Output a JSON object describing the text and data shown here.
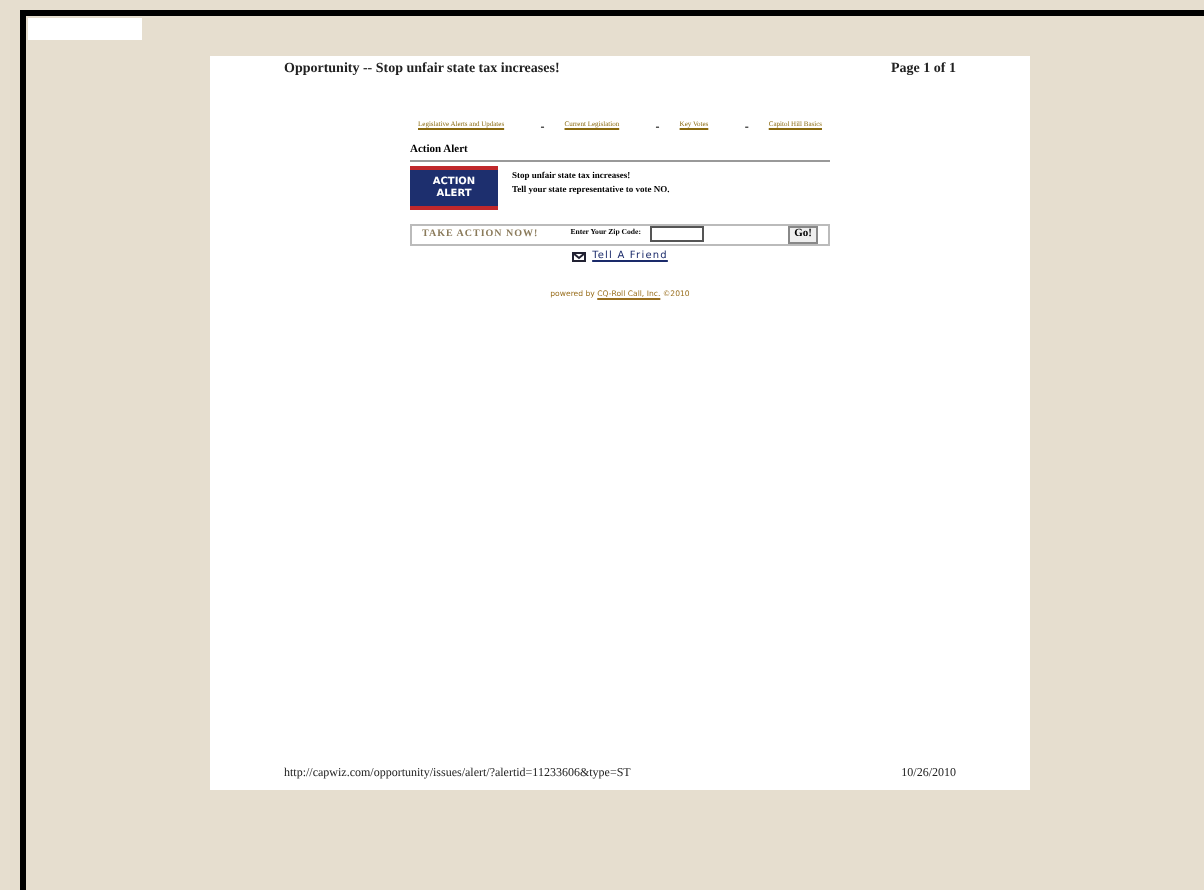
{
  "page": {
    "header_title": "Opportunity -- Stop unfair state tax increases!",
    "page_number": "Page 1 of 1",
    "nav_links": [
      {
        "label": "Legislative Alerts and Updates"
      },
      {
        "label": "Current Legislation"
      },
      {
        "label": "Key Votes"
      },
      {
        "label": "Capitol Hill Basics"
      }
    ],
    "nav_separator": "-",
    "section_title": "Action Alert",
    "badge_lines": [
      "ACTION",
      "ALERT"
    ],
    "alert_headline": "Stop unfair state tax increases!",
    "alert_text": "Tell your state representative to vote NO.",
    "take_action": "TAKE ACTION NOW!",
    "zip_label": "Enter Your Zip Code:",
    "go_button": "Go!",
    "tell_friend": "Tell A Friend",
    "powered_prefix": "powered by ",
    "powered_link": "CQ-Roll Call, Inc.",
    "powered_suffix": " ©2010",
    "footer_url": "http://capwiz.com/opportunity/issues/alert/?alertid=11233606&type=ST",
    "footer_date": "10/26/2010"
  }
}
